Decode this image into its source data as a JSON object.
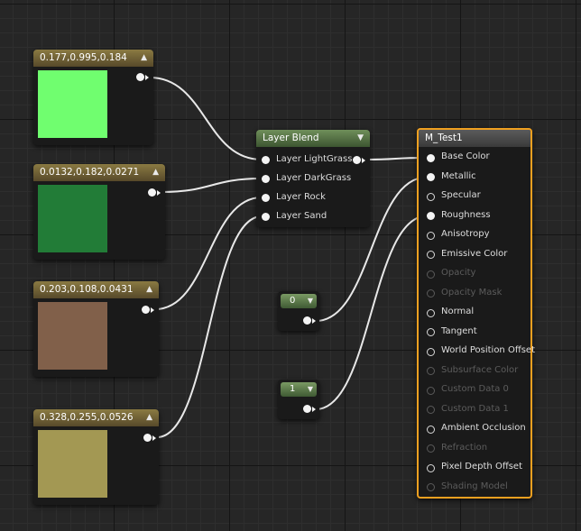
{
  "color_nodes": [
    {
      "label": "0.177,0.995,0.184",
      "swatch": "#70fe6f"
    },
    {
      "label": "0.0132,0.182,0.0271",
      "swatch": "#227c37"
    },
    {
      "label": "0.203,0.108,0.0431",
      "swatch": "#81604a"
    },
    {
      "label": "0.328,0.255,0.0526",
      "swatch": "#a39853"
    }
  ],
  "layer_blend": {
    "title": "Layer Blend",
    "inputs": [
      "Layer LightGrass",
      "Layer DarkGrass",
      "Layer Rock",
      "Layer Sand"
    ]
  },
  "constants": [
    {
      "value": "0"
    },
    {
      "value": "1"
    }
  ],
  "material": {
    "title": "M_Test1",
    "pins": [
      {
        "label": "Base Color",
        "state": "filled"
      },
      {
        "label": "Metallic",
        "state": "filled"
      },
      {
        "label": "Specular",
        "state": "hollow"
      },
      {
        "label": "Roughness",
        "state": "filled"
      },
      {
        "label": "Anisotropy",
        "state": "hollow"
      },
      {
        "label": "Emissive Color",
        "state": "hollow"
      },
      {
        "label": "Opacity",
        "state": "disabled"
      },
      {
        "label": "Opacity Mask",
        "state": "disabled"
      },
      {
        "label": "Normal",
        "state": "hollow"
      },
      {
        "label": "Tangent",
        "state": "hollow"
      },
      {
        "label": "World Position Offset",
        "state": "hollow"
      },
      {
        "label": "Subsurface Color",
        "state": "disabled"
      },
      {
        "label": "Custom Data 0",
        "state": "disabled"
      },
      {
        "label": "Custom Data 1",
        "state": "disabled"
      },
      {
        "label": "Ambient Occlusion",
        "state": "hollow"
      },
      {
        "label": "Refraction",
        "state": "disabled"
      },
      {
        "label": "Pixel Depth Offset",
        "state": "hollow"
      },
      {
        "label": "Shading Model",
        "state": "disabled"
      }
    ]
  },
  "colors": {
    "material_border": "#f0a020",
    "wire": "#e8e8e8"
  },
  "icons": {
    "collapse": "chevron-up-icon",
    "expand": "chevron-down-icon"
  }
}
